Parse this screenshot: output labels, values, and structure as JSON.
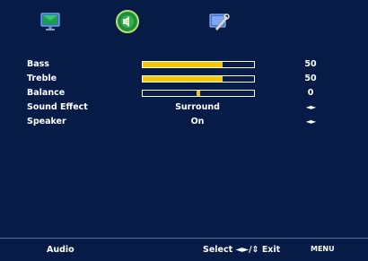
{
  "menu": {
    "tabs": [
      {
        "icon": "monitor-icon"
      },
      {
        "icon": "speaker-disc-icon"
      },
      {
        "icon": "wrench-setup-icon"
      }
    ],
    "active_tab": 1
  },
  "settings": {
    "bass": {
      "label": "Bass",
      "value": "50",
      "level": 0.72
    },
    "treble": {
      "label": "Treble",
      "value": "50",
      "level": 0.72
    },
    "balance": {
      "label": "Balance",
      "value": "0",
      "level": 0.5
    },
    "sound_effect": {
      "label": "Sound Effect",
      "value": "Surround",
      "arrows": "◄►"
    },
    "speaker": {
      "label": "Speaker",
      "value": "On",
      "arrows": "◄►"
    }
  },
  "footer": {
    "title": "Audio",
    "select_label": "Select ◄►/⇕ Exit",
    "menu_label": "MENU"
  },
  "colors": {
    "background": "#071b47",
    "accent": "#f5c800",
    "text": "#ffffff"
  }
}
